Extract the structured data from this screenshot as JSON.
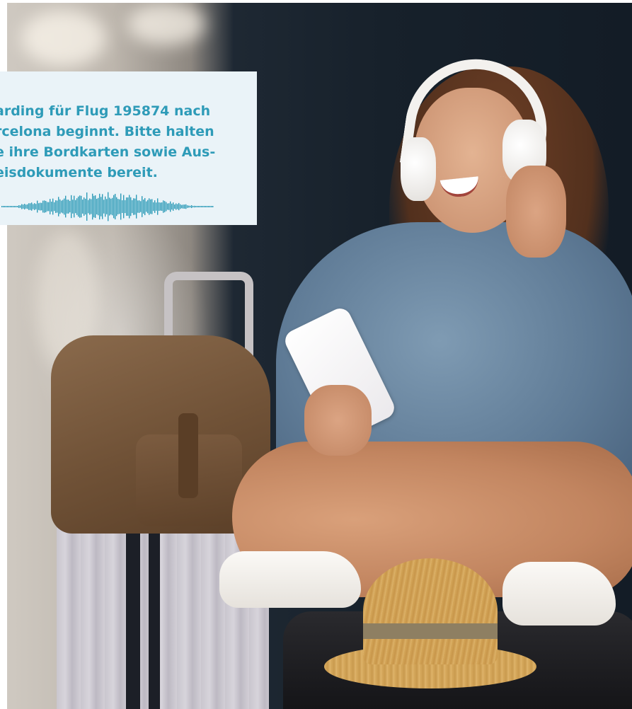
{
  "announcement": {
    "lines": [
      "arding für Flug 195874 nach",
      "rcelona beginnt. Bitte halten",
      "e ihre Bordkarten sowie Aus-",
      "eisdokumente bereit."
    ],
    "text_color": "#2e9bb8",
    "background_color": "#eaf3f8"
  },
  "icons": {
    "audio_waveform": "audio-waveform-icon"
  },
  "photo": {
    "subject": "woman-with-headphones-and-phone"
  }
}
